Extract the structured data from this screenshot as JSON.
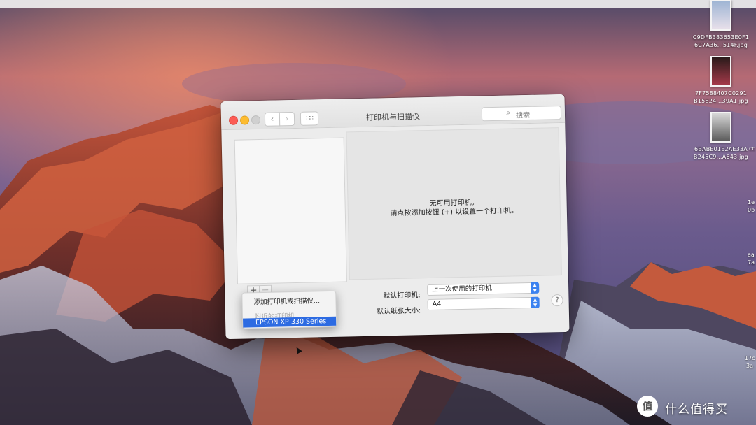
{
  "window": {
    "title": "打印机与扫描仪",
    "search_placeholder": "搜索",
    "nav": {
      "back": "‹",
      "forward": "›",
      "show_all": "∷∷"
    },
    "empty_message_line1": "无可用打印机。",
    "empty_message_line2": "请点按添加按钮 (+) 以设置一个打印机。",
    "add_symbol": "+",
    "remove_symbol": "−",
    "default_printer": {
      "label": "默认打印机:",
      "value": "上一次使用的打印机"
    },
    "paper_size": {
      "label": "默认纸张大小:",
      "value": "A4"
    },
    "help": "?"
  },
  "add_menu": {
    "add_item": "添加打印机或扫描仪...",
    "section_label": "附近的打印机",
    "printer": "EPSON XP-330 Series"
  },
  "desktop": {
    "files": [
      {
        "line1": "C9DFB383653E0F1",
        "line2": "6C7A36...514F.jpg"
      },
      {
        "line1": "7F7588407C0291",
        "line2": "B15824...39A1.jpg"
      },
      {
        "line1": "6BABE01E2AE33A",
        "line2": "B245C9...A643.jpg"
      }
    ],
    "edge_labels": [
      "cc",
      "1e",
      "0b",
      "aa",
      "7a",
      "17c",
      "3a"
    ]
  },
  "watermark": {
    "logo": "值",
    "text": "什么值得买"
  }
}
